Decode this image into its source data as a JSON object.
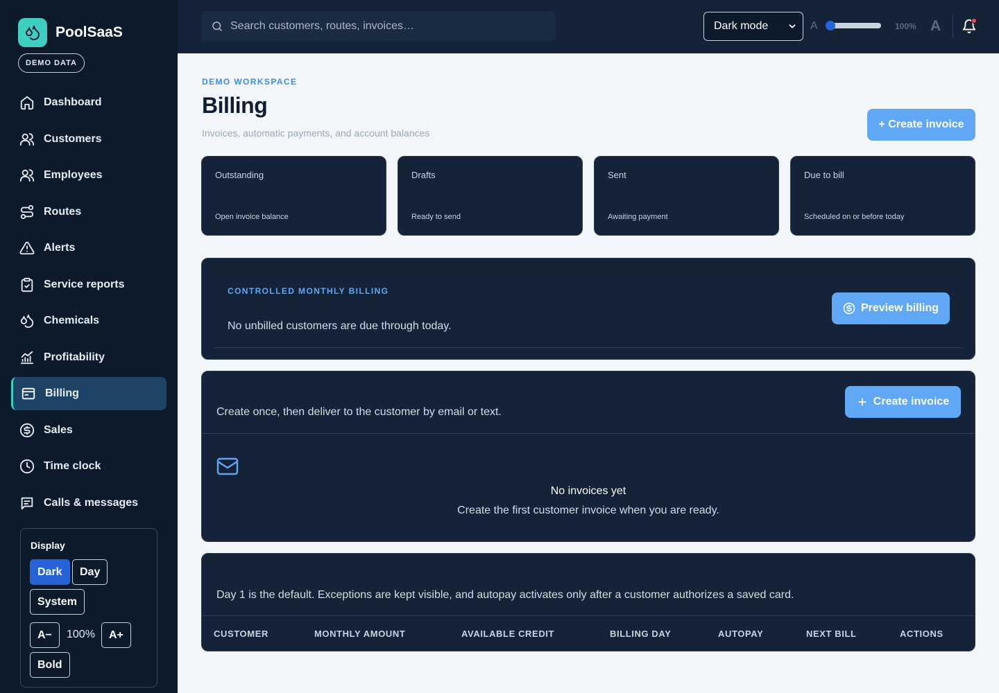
{
  "brand": {
    "name": "PoolSaaS",
    "badge": "DEMO DATA"
  },
  "nav": [
    {
      "label": "Dashboard",
      "icon": "home-icon"
    },
    {
      "label": "Customers",
      "icon": "users-icon"
    },
    {
      "label": "Employees",
      "icon": "users-icon"
    },
    {
      "label": "Routes",
      "icon": "route-icon"
    },
    {
      "label": "Alerts",
      "icon": "alert-triangle-icon"
    },
    {
      "label": "Service reports",
      "icon": "clipboard-check-icon"
    },
    {
      "label": "Chemicals",
      "icon": "droplets-icon"
    },
    {
      "label": "Profitability",
      "icon": "bar-chart-icon"
    },
    {
      "label": "Billing",
      "icon": "receipt-icon",
      "active": true
    },
    {
      "label": "Sales",
      "icon": "dollar-circle-icon"
    },
    {
      "label": "Time clock",
      "icon": "clock-icon"
    },
    {
      "label": "Calls & messages",
      "icon": "message-icon"
    }
  ],
  "display": {
    "title": "Display",
    "dark": "Dark",
    "day": "Day",
    "system": "System",
    "decrease": "A−",
    "zoom": "100%",
    "increase": "A+",
    "bold": "Bold"
  },
  "topbar": {
    "search_placeholder": "Search customers, routes, invoices…",
    "mode": "Dark mode",
    "a_small": "A",
    "zoom": "100%",
    "a_big": "A"
  },
  "page": {
    "eyebrow": "DEMO WORKSPACE",
    "title": "Billing",
    "subtitle": "Invoices, automatic payments, and account balances",
    "create_invoice": "+ Create invoice"
  },
  "stats": [
    {
      "label": "Outstanding",
      "value": "",
      "hint": "Open invoice balance"
    },
    {
      "label": "Drafts",
      "value": "",
      "hint": "Ready to send"
    },
    {
      "label": "Sent",
      "value": "",
      "hint": "Awaiting payment"
    },
    {
      "label": "Due to bill",
      "value": "",
      "hint": "Scheduled on or before today"
    }
  ],
  "monthly": {
    "eyebrow": "CONTROLLED MONTHLY BILLING",
    "text": "No unbilled customers are due through today.",
    "preview": "Preview billing"
  },
  "invoices": {
    "text": "Create once, then deliver to the customer by email or text.",
    "create": "Create invoice",
    "empty_title": "No invoices yet",
    "empty_sub": "Create the first customer invoice when you are ready."
  },
  "autopay": {
    "text": "Day 1 is the default. Exceptions are kept visible, and autopay activates only after a customer authorizes a saved card.",
    "columns": [
      "CUSTOMER",
      "MONTHLY AMOUNT",
      "AVAILABLE CREDIT",
      "BILLING DAY",
      "AUTOPAY",
      "NEXT BILL",
      "ACTIONS"
    ]
  },
  "colors": {
    "accent": "#60a8f5",
    "brand": "#3ecfc2",
    "sidebar": "#0c1a2b",
    "panel": "#142338"
  }
}
